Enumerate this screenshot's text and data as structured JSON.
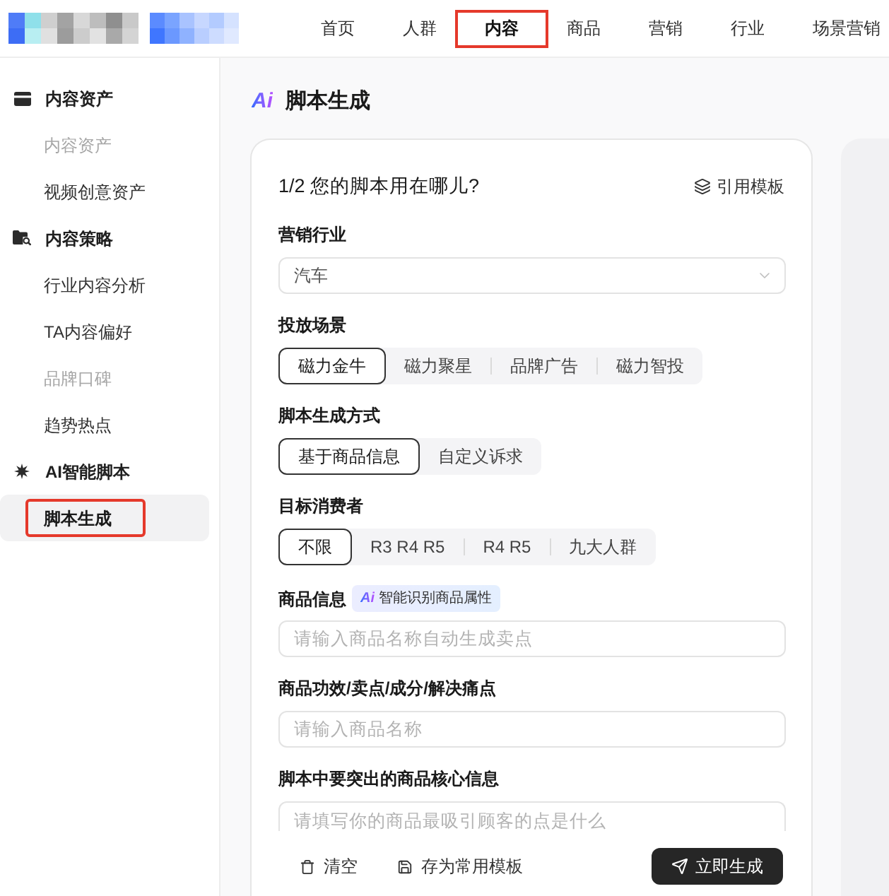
{
  "top_nav": {
    "items": [
      {
        "label": "首页",
        "selected": false,
        "highlighted": false
      },
      {
        "label": "人群",
        "selected": false,
        "highlighted": false
      },
      {
        "label": "内容",
        "selected": true,
        "highlighted": true
      },
      {
        "label": "商品",
        "selected": false,
        "highlighted": false
      },
      {
        "label": "营销",
        "selected": false,
        "highlighted": false
      },
      {
        "label": "行业",
        "selected": false,
        "highlighted": false
      },
      {
        "label": "场景营销",
        "selected": false,
        "highlighted": false
      }
    ]
  },
  "sidebar": {
    "groups": [
      {
        "label": "内容资产",
        "items": [
          {
            "label": "内容资产",
            "disabled": true,
            "selected": false,
            "highlighted": false
          },
          {
            "label": "视频创意资产",
            "disabled": false,
            "selected": false,
            "highlighted": false
          }
        ]
      },
      {
        "label": "内容策略",
        "items": [
          {
            "label": "行业内容分析",
            "disabled": false,
            "selected": false,
            "highlighted": false
          },
          {
            "label": "TA内容偏好",
            "disabled": false,
            "selected": false,
            "highlighted": false
          },
          {
            "label": "品牌口碑",
            "disabled": true,
            "selected": false,
            "highlighted": false
          },
          {
            "label": "趋势热点",
            "disabled": false,
            "selected": false,
            "highlighted": false
          }
        ]
      },
      {
        "label": "AI智能脚本",
        "items": [
          {
            "label": "脚本生成",
            "disabled": false,
            "selected": true,
            "highlighted": true
          }
        ]
      }
    ]
  },
  "page": {
    "logo_text": "Ai",
    "title": "脚本生成"
  },
  "form": {
    "step": "1/2 您的脚本用在哪儿?",
    "template_link": "引用模板",
    "fields": [
      {
        "kind": "select",
        "label": "营销行业",
        "value": "汽车"
      },
      {
        "kind": "segmented",
        "label": "投放场景",
        "options": [
          {
            "label": "磁力金牛",
            "selected": true
          },
          {
            "label": "磁力聚星",
            "selected": false
          },
          {
            "label": "品牌广告",
            "selected": false
          },
          {
            "label": "磁力智投",
            "selected": false
          }
        ]
      },
      {
        "kind": "segmented",
        "label": "脚本生成方式",
        "options": [
          {
            "label": "基于商品信息",
            "selected": true
          },
          {
            "label": "自定义诉求",
            "selected": false
          }
        ]
      },
      {
        "kind": "segmented",
        "label": "目标消费者",
        "options": [
          {
            "label": "不限",
            "selected": true
          },
          {
            "label": "R3 R4 R5",
            "selected": false
          },
          {
            "label": "R4 R5",
            "selected": false
          },
          {
            "label": "九大人群",
            "selected": false
          }
        ]
      },
      {
        "kind": "input",
        "label": "商品信息",
        "badge": {
          "logo_text": "Ai",
          "text": "智能识别商品属性"
        },
        "placeholder": "请输入商品名称自动生成卖点"
      },
      {
        "kind": "input",
        "label": "商品功效/卖点/成分/解决痛点",
        "placeholder": "请输入商品名称"
      },
      {
        "kind": "input",
        "label": "脚本中要突出的商品核心信息",
        "placeholder": "请填写你的商品最吸引顾客的点是什么"
      }
    ],
    "actions": [
      {
        "kind": "clear",
        "label": "清空"
      },
      {
        "kind": "save",
        "label": "存为常用模板"
      },
      {
        "kind": "submit",
        "label": "立即生成"
      }
    ]
  }
}
